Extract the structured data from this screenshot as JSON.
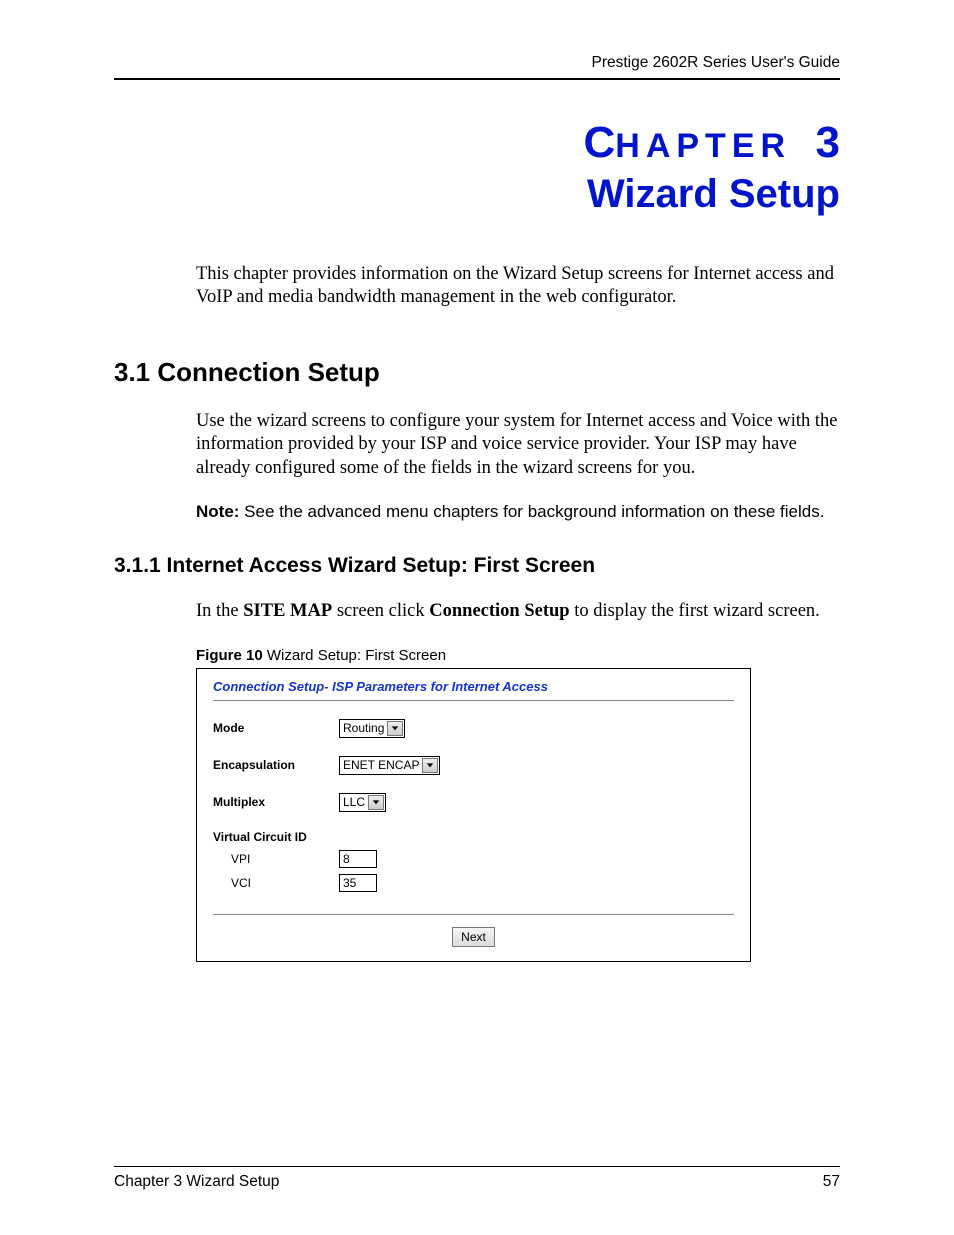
{
  "header": {
    "guide": "Prestige 2602R Series User's Guide"
  },
  "chapter": {
    "label_prefix": "C",
    "label_mid": "HAPTER",
    "number": "3",
    "title": "Wizard Setup"
  },
  "intro": "This chapter provides information on the Wizard Setup screens for Internet access and VoIP and media bandwidth management in the web configurator.",
  "section_3_1": {
    "heading": "3.1  Connection Setup",
    "body": "Use the wizard screens to configure your system for Internet access and Voice with the information provided by your ISP and voice service provider. Your ISP may have already configured some of the fields in the wizard screens for you.",
    "note_label": "Note:",
    "note_text": " See the advanced menu chapters for background information on these fields."
  },
  "section_3_1_1": {
    "heading": "3.1.1  Internet Access Wizard Setup: First Screen",
    "body_prefix": "In the ",
    "body_bold1": "SITE MAP",
    "body_mid": " screen click ",
    "body_bold2": "Connection Setup",
    "body_suffix": " to display the first wizard screen."
  },
  "figure": {
    "label": "Figure 10   ",
    "caption": "Wizard Setup: First Screen"
  },
  "wizard": {
    "title": "Connection Setup- ISP Parameters for Internet Access",
    "mode_label": "Mode",
    "mode_value": "Routing",
    "encap_label": "Encapsulation",
    "encap_value": "ENET ENCAP",
    "multiplex_label": "Multiplex",
    "multiplex_value": "LLC",
    "vcid_label": "Virtual Circuit ID",
    "vpi_label": "VPI",
    "vpi_value": "8",
    "vci_label": "VCI",
    "vci_value": "35",
    "next": "Next"
  },
  "footer": {
    "left": "Chapter 3 Wizard Setup",
    "page": "57"
  }
}
